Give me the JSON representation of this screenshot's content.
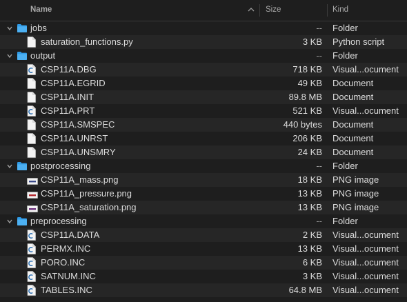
{
  "columns": {
    "name": "Name",
    "size": "Size",
    "kind": "Kind"
  },
  "rows": [
    {
      "name": "jobs",
      "size": "--",
      "kind": "Folder",
      "type": "folder",
      "level": 0,
      "expanded": true
    },
    {
      "name": "saturation_functions.py",
      "size": "3 KB",
      "kind": "Python script",
      "type": "doc",
      "level": 1
    },
    {
      "name": "output",
      "size": "--",
      "kind": "Folder",
      "type": "folder",
      "level": 0,
      "expanded": true
    },
    {
      "name": "CSP11A.DBG",
      "size": "718 KB",
      "kind": "Visual...ocument",
      "type": "code",
      "level": 1
    },
    {
      "name": "CSP11A.EGRID",
      "size": "49 KB",
      "kind": "Document",
      "type": "doc",
      "level": 1
    },
    {
      "name": "CSP11A.INIT",
      "size": "89.8 MB",
      "kind": "Document",
      "type": "doc",
      "level": 1
    },
    {
      "name": "CSP11A.PRT",
      "size": "521 KB",
      "kind": "Visual...ocument",
      "type": "code",
      "level": 1
    },
    {
      "name": "CSP11A.SMSPEC",
      "size": "440 bytes",
      "kind": "Document",
      "type": "doc",
      "level": 1
    },
    {
      "name": "CSP11A.UNRST",
      "size": "206 KB",
      "kind": "Document",
      "type": "doc",
      "level": 1
    },
    {
      "name": "CSP11A.UNSMRY",
      "size": "24 KB",
      "kind": "Document",
      "type": "doc",
      "level": 1
    },
    {
      "name": "postprocessing",
      "size": "--",
      "kind": "Folder",
      "type": "folder",
      "level": 0,
      "expanded": true
    },
    {
      "name": "CSP11A_mass.png",
      "size": "18 KB",
      "kind": "PNG image",
      "type": "image",
      "level": 1,
      "accent": "#3b4a8a"
    },
    {
      "name": "CSP11A_pressure.png",
      "size": "13 KB",
      "kind": "PNG image",
      "type": "image",
      "level": 1,
      "accent": "#b3262c"
    },
    {
      "name": "CSP11A_saturation.png",
      "size": "13 KB",
      "kind": "PNG image",
      "type": "image",
      "level": 1,
      "accent": "#6a2d7a"
    },
    {
      "name": "preprocessing",
      "size": "--",
      "kind": "Folder",
      "type": "folder",
      "level": 0,
      "expanded": true
    },
    {
      "name": "CSP11A.DATA",
      "size": "2 KB",
      "kind": "Visual...ocument",
      "type": "code",
      "level": 1
    },
    {
      "name": "PERMX.INC",
      "size": "13 KB",
      "kind": "Visual...ocument",
      "type": "code",
      "level": 1
    },
    {
      "name": "PORO.INC",
      "size": "6 KB",
      "kind": "Visual...ocument",
      "type": "code",
      "level": 1
    },
    {
      "name": "SATNUM.INC",
      "size": "3 KB",
      "kind": "Visual...ocument",
      "type": "code",
      "level": 1
    },
    {
      "name": "TABLES.INC",
      "size": "64.8 MB",
      "kind": "Visual...ocument",
      "type": "code",
      "level": 1
    }
  ],
  "colors": {
    "folder": "#2f9be6",
    "accent_code": "#2b6fb3",
    "alt_row": "#262626"
  }
}
